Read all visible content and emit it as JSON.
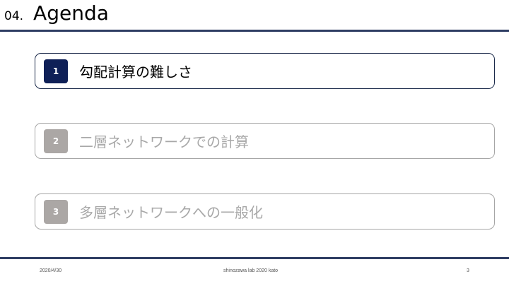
{
  "header": {
    "number": "04.",
    "title": "Agenda"
  },
  "agenda": {
    "items": [
      {
        "number": "1",
        "label": "勾配計算の難しさ",
        "active": true
      },
      {
        "number": "2",
        "label": "二層ネットワークでの計算",
        "active": false
      },
      {
        "number": "3",
        "label": "多層ネットワークへの一般化",
        "active": false
      }
    ]
  },
  "footer": {
    "date": "2020/4/30",
    "center": "shinozawa lab 2020 kato",
    "page": "3"
  },
  "colors": {
    "rule": "#2e3d63",
    "active_badge": "#0f2057",
    "inactive_badge": "#aba7a5",
    "inactive_text": "#a8a8a8"
  }
}
